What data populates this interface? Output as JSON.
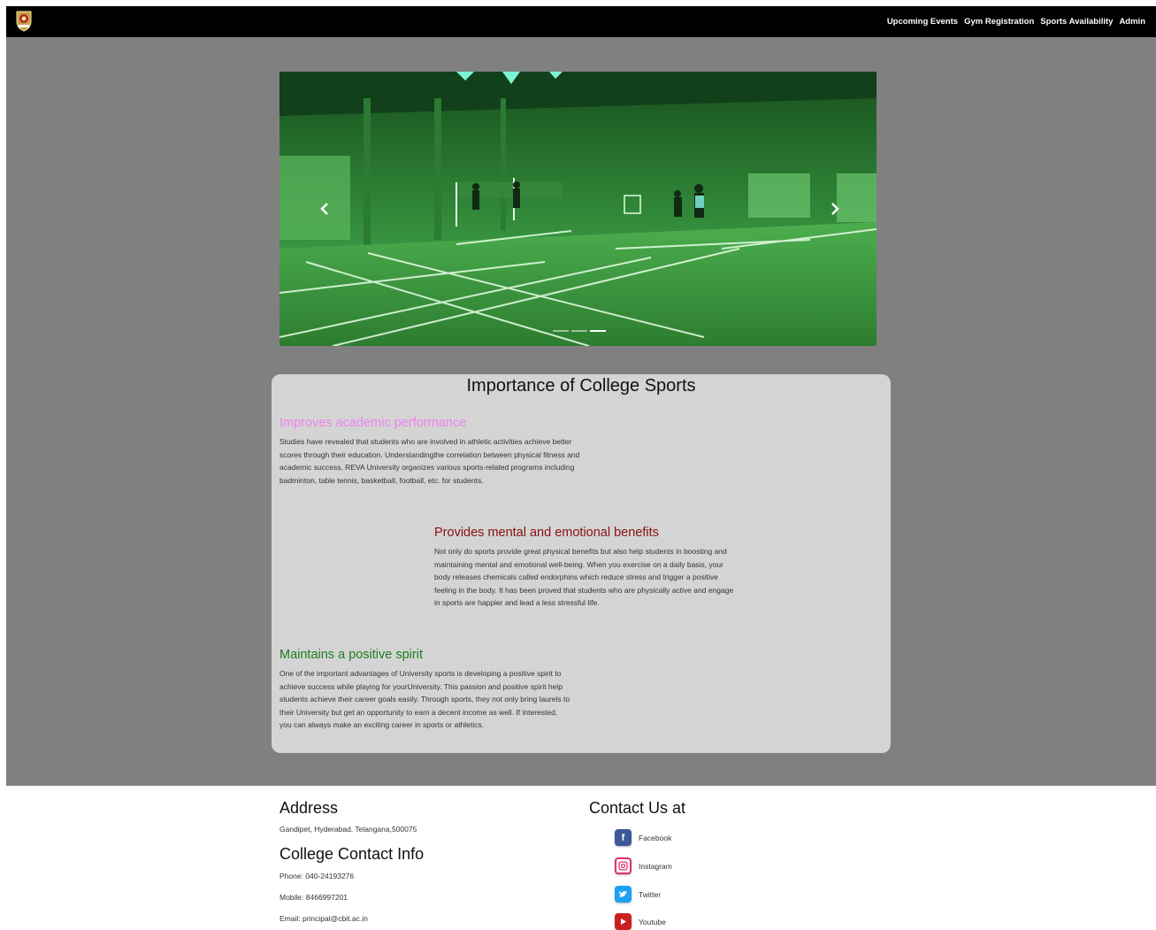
{
  "nav": {
    "links": [
      "Upcoming Events",
      "Gym Registration",
      "Sports Availability",
      "Admin"
    ]
  },
  "carousel": {
    "slide_count": 3,
    "active_slide_index": 2
  },
  "content": {
    "title": "Importance of College Sports",
    "sections": [
      {
        "heading": "Improves academic performance",
        "color": "#ee82ee",
        "text": "Studies have revealed that students who are involved in athletic activities achieve better scores through their education. Understandingthe correlation between physical fitness and academic success, REVA University organizes various sports-related programs including badminton, table tennis, basketball, football, etc. for students."
      },
      {
        "heading": "Provides mental and emotional benefits",
        "color": "#8b1010",
        "text": "Not only do sports provide great physical benefits but also help students in boosting and maintaining mental and emotional well-being. When you exercise on a daily basis, your body releases chemicals called endorphins which reduce stress and trigger a positive feeling in the body. It has been proved that students who are physically active and engage in sports are happier and lead a less stressful life."
      },
      {
        "heading": "Maintains a positive spirit",
        "color": "#1e7d1e",
        "text": "One of the important advantages of University sports is developing a positive spirit to achieve success while playing for yourUniversity. This passion and positive spirit help students achieve their career goals easily. Through sports, they not only bring laurels to their University but get an opportunity to earn a decent income as well. If interested, you can always make an exciting career in sports or athletics."
      }
    ]
  },
  "footer": {
    "address_heading": "Address",
    "address": "Gandipet, Hyderabad, Telangana,500075",
    "contact_heading": "College Contact Info",
    "phone": "Phone: 040-24193276",
    "mobile": "Mobile: 8466997201",
    "email": "Email: principal@cbit.ac.in",
    "social_heading": "Contact Us at",
    "social": [
      {
        "label": "Facebook",
        "icon": "facebook-icon",
        "color": "#3b5998"
      },
      {
        "label": "Instagram",
        "icon": "instagram-icon",
        "color": "#e1306c"
      },
      {
        "label": "Twitter",
        "icon": "twitter-icon",
        "color": "#1da1f2"
      },
      {
        "label": "Youtube",
        "icon": "youtube-icon",
        "color": "#cc2020"
      }
    ]
  }
}
